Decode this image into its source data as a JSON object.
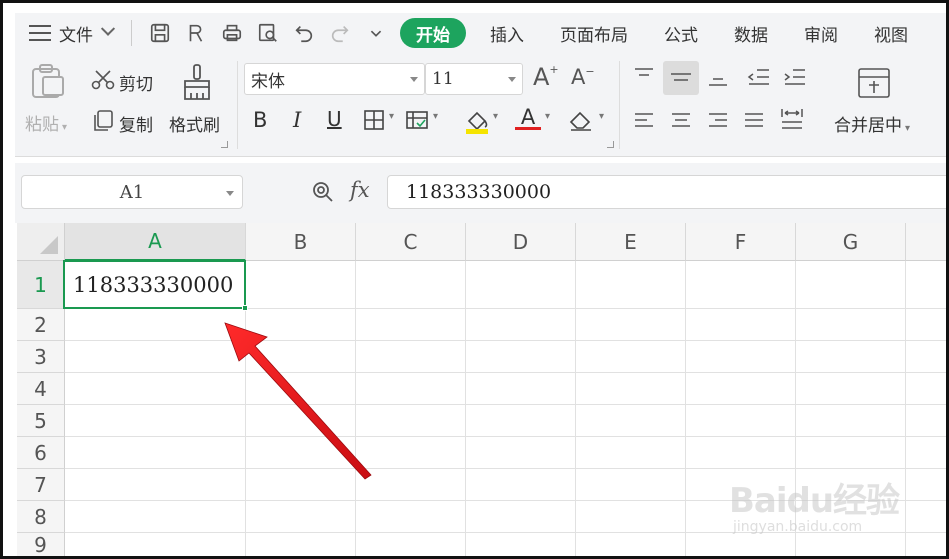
{
  "menubar": {
    "file_label": "文件",
    "tabs": [
      {
        "label": "开始",
        "active": true
      },
      {
        "label": "插入"
      },
      {
        "label": "页面布局"
      },
      {
        "label": "公式"
      },
      {
        "label": "数据"
      },
      {
        "label": "审阅"
      },
      {
        "label": "视图"
      }
    ]
  },
  "ribbon": {
    "paste_label": "粘贴",
    "cut_label": "剪切",
    "copy_label": "复制",
    "format_painter_label": "格式刷",
    "font_name": "宋体",
    "font_size": "11",
    "merge_center_label": "合并居中",
    "font_color": "#e02020",
    "fill_color": "#f5e400"
  },
  "formula_bar": {
    "name_box": "A1",
    "fx_label": "fx",
    "formula_value": "118333330000"
  },
  "grid": {
    "columns": [
      "A",
      "B",
      "C",
      "D",
      "E",
      "F",
      "G"
    ],
    "rows": [
      "1",
      "2",
      "3",
      "4",
      "5",
      "6",
      "7",
      "8",
      "9"
    ],
    "cell_a1": "118333330000",
    "selected_cell": "A1"
  },
  "colors": {
    "accent": "#1da45e",
    "selection": "#1a9950",
    "arrow": "#e8161b"
  },
  "watermark": {
    "brand": "Baidu经验",
    "url": "jingyan.baidu.com"
  }
}
